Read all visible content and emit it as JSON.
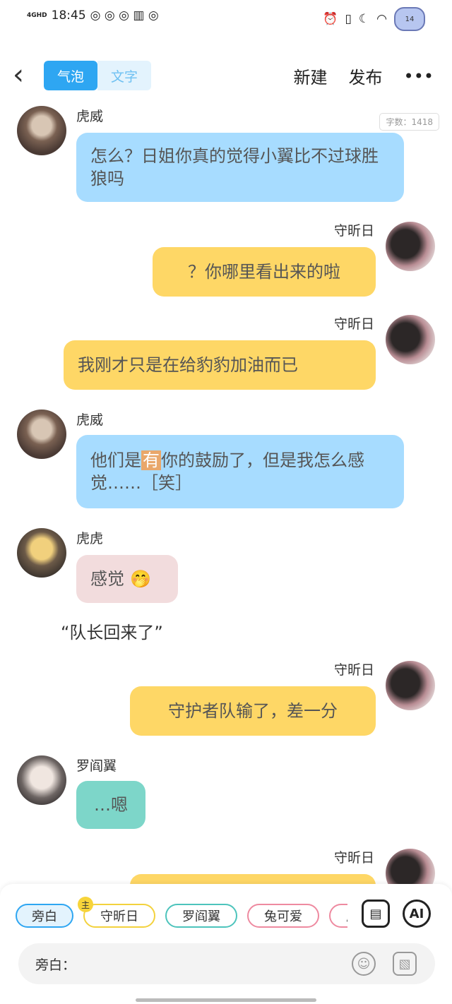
{
  "status": {
    "network": "4GHD",
    "time": "18:45",
    "heart_badge": "14"
  },
  "nav": {
    "back_icon": "back-arrow-icon",
    "tab_active": "气泡",
    "tab_inactive": "文字",
    "new_label": "新建",
    "publish_label": "发布",
    "more_icon": "more-icon"
  },
  "word_count": "字数：1418",
  "messages": [
    {
      "name": "虎威",
      "text": "怎么？日姐你真的觉得小翼比不过球胜狼吗"
    },
    {
      "name": "守昕日",
      "text": "？你哪里看出来的啦"
    },
    {
      "name": "守昕日",
      "text": "我刚才只是在给豹豹加油而已"
    },
    {
      "name": "虎威",
      "text_before": "他们是",
      "highlight": "有",
      "text_after": "你的鼓励了，但是我怎么感觉……［笑］"
    },
    {
      "name": "虎虎",
      "text": "感觉",
      "emoji": "🤭"
    },
    {
      "narration": "“队长回来了”"
    },
    {
      "name": "守昕日",
      "text": "守护者队输了，差一分"
    },
    {
      "name": "罗阎翼",
      "text": "…嗯"
    },
    {
      "name": "守昕日"
    }
  ],
  "roles": {
    "chips": [
      "旁白",
      "守昕日",
      "罗阎翼",
      "兔可爱",
      "虎"
    ],
    "owner_badge": "主",
    "tool_card_icon": "character-card-icon",
    "ai_label": "AI"
  },
  "composer": {
    "prefix": "旁白：",
    "emoji_icon": "emoji-icon",
    "image_icon": "image-icon"
  }
}
